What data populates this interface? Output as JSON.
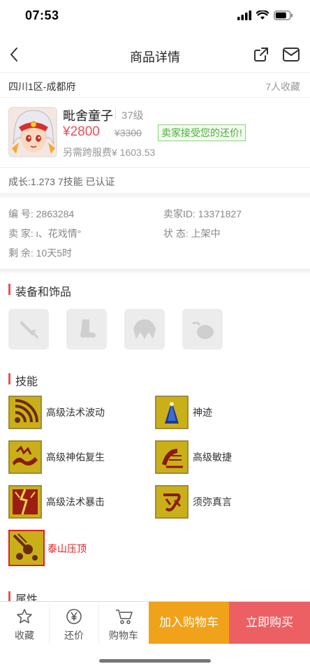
{
  "status_bar": {
    "time": "07:53"
  },
  "nav": {
    "title": "商品详情",
    "icons": [
      "back-chevron-icon",
      "share-icon",
      "mail-icon"
    ]
  },
  "server": {
    "name": "四川1区-成都府",
    "fav_count": "7人收藏"
  },
  "product": {
    "name": "毗舍童子",
    "level": "37级",
    "price": "¥2800",
    "old_price": "¥3300",
    "bargain": "卖家接受您的还价!",
    "fee": "另需跨服费¥ 1603.53"
  },
  "growth": "成长:1.273 7技能 已认证",
  "info": {
    "id_label": "编 号:",
    "id_value": "2863284",
    "seller_label": "卖 家:",
    "seller_value": "ι、花戏情°",
    "remain_label": "剩 余:",
    "remain_value": "10天5时",
    "seller_id_label": "卖家ID:",
    "seller_id_value": "13371827",
    "state_label": "状 态:",
    "state_value": "上架中"
  },
  "sections": {
    "equipment": "装备和饰品",
    "skills": "技能",
    "attributes": "属性"
  },
  "equipment_slots": [
    "weapon-slot-icon",
    "boots-slot-icon",
    "armor-slot-icon",
    "accessory-slot-icon"
  ],
  "skills": [
    {
      "name": "高级法术波动",
      "icon": "wave-skill-icon"
    },
    {
      "name": "神迹",
      "icon": "miracle-skill-icon"
    },
    {
      "name": "高级神佑复生",
      "icon": "revive-skill-icon"
    },
    {
      "name": "高级敏捷",
      "icon": "agility-skill-icon"
    },
    {
      "name": "高级法术暴击",
      "icon": "crit-skill-icon"
    },
    {
      "name": "须弥真言",
      "icon": "mantra-skill-icon"
    },
    {
      "name": "泰山压顶",
      "icon": "meteor-skill-icon"
    }
  ],
  "bottom": {
    "favorite": "收藏",
    "counter_offer": "还价",
    "cart": "购物车",
    "add_to_cart": "加入购物车",
    "buy_now": "立即购买"
  },
  "colors": {
    "accent_red": "#e8525a",
    "cart_orange": "#f0a21a",
    "buy_red": "#ec6064",
    "bargain_green": "#4cae3d"
  }
}
